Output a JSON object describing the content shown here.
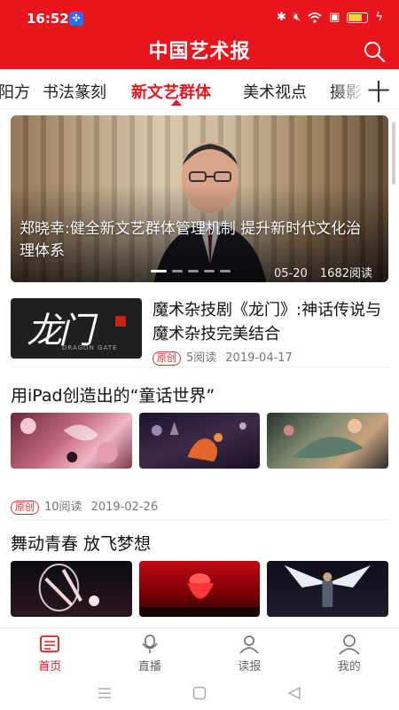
{
  "status_bar": {
    "time": "16:52",
    "battery_level": 0.8
  },
  "header": {
    "brand": "中国艺术报",
    "search_icon": "search-icon"
  },
  "tabs": {
    "items": [
      {
        "label": "阳方"
      },
      {
        "label": "书法篆刻"
      },
      {
        "label": "新文艺群体",
        "active": true
      },
      {
        "label": "美术视点"
      },
      {
        "label": "摄影"
      }
    ],
    "more_label": "十"
  },
  "banner": {
    "headline": "郑晓幸:健全新文艺群体管理机制 提升新时代文化治理体系",
    "date": "05-20",
    "reads": "1682阅读",
    "slide_count": 5,
    "active_slide": 0
  },
  "articles": [
    {
      "title": "魔术杂技剧《龙门》:神话传说与魔术杂技完美结合",
      "tag": "原创",
      "reads": "5阅读",
      "date": "2019-04-17",
      "thumb_text": "龙门",
      "thumb_subtitle": "DRAGON GATE"
    },
    {
      "title": "用iPad创造出的“童话世界”",
      "tag": "原创",
      "reads": "10阅读",
      "date": "2019-02-26"
    },
    {
      "title": "舞动青春 放飞梦想"
    }
  ],
  "bottom_nav": {
    "items": [
      {
        "label": "首页",
        "icon": "news-icon",
        "active": true
      },
      {
        "label": "直播",
        "icon": "microphone-icon"
      },
      {
        "label": "读报",
        "icon": "reader-icon"
      },
      {
        "label": "我的",
        "icon": "profile-icon"
      }
    ]
  },
  "colors": {
    "brand_red": "#e8161c",
    "tag_red": "#dd3333"
  }
}
